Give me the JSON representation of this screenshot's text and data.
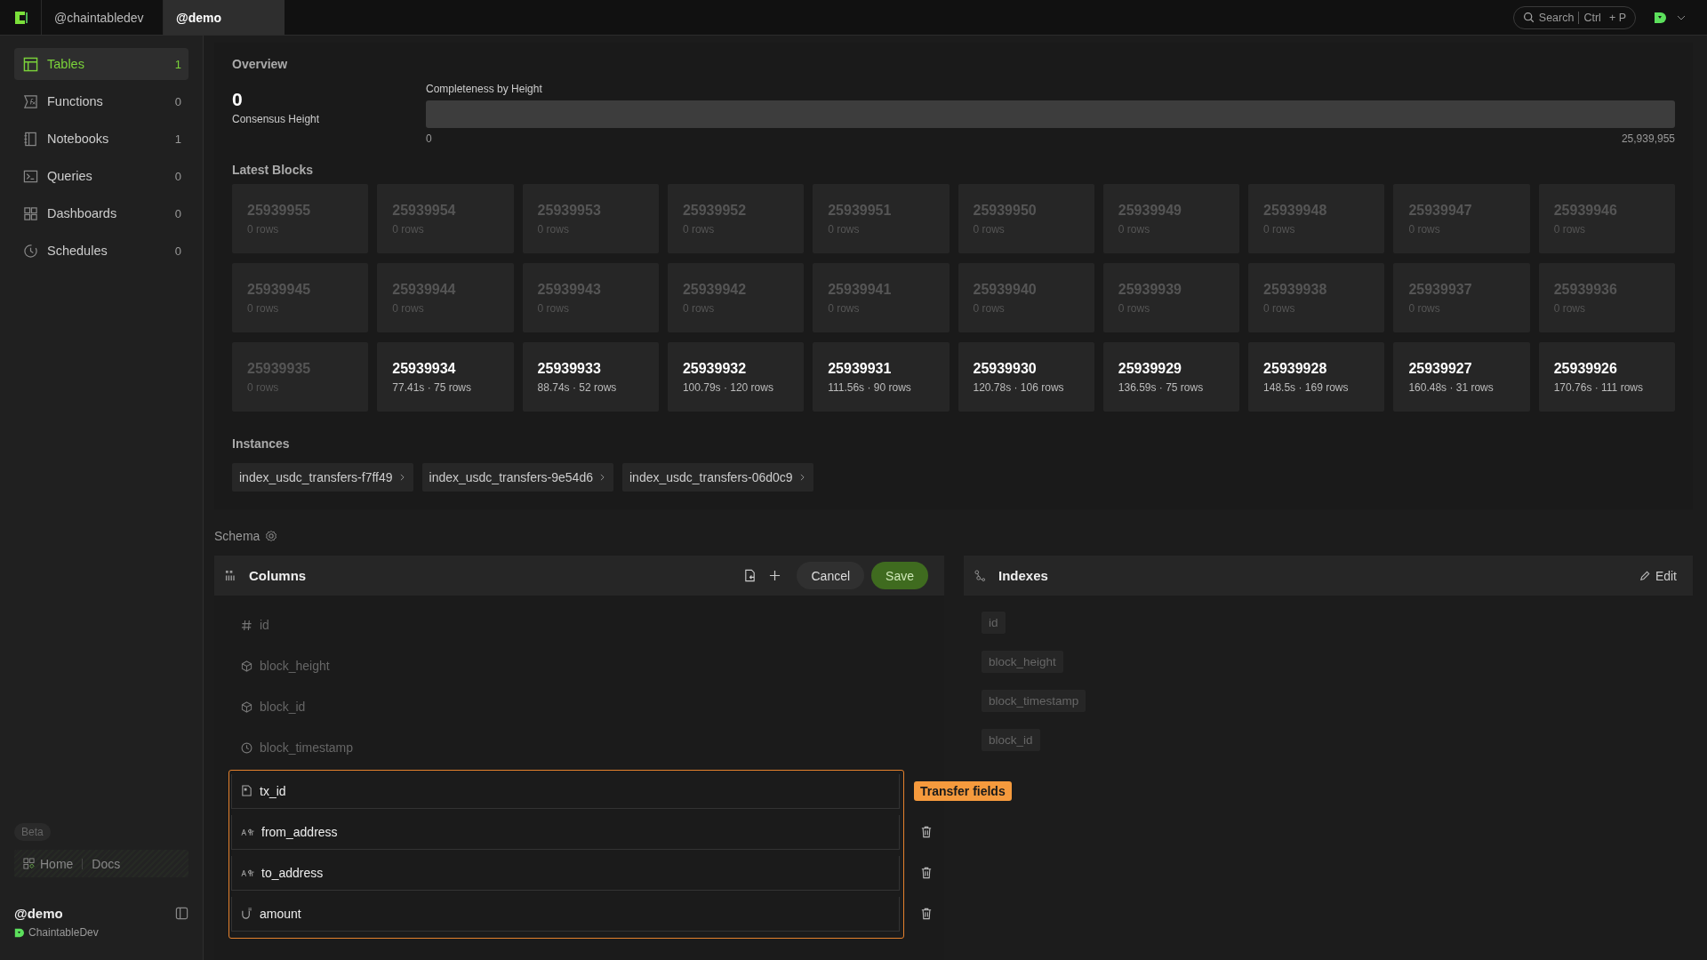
{
  "workspace_tabs": [
    {
      "label": "@chaintabledev",
      "selected": false
    },
    {
      "label": "@demo",
      "selected": true
    }
  ],
  "search": {
    "label": "Search",
    "shortcut_key": "Ctrl",
    "shortcut_plus": "+ P"
  },
  "sidebar": {
    "items": [
      {
        "kind": "tables",
        "label": "Tables",
        "count": "1",
        "selected": true
      },
      {
        "kind": "functions",
        "label": "Functions",
        "count": "0",
        "selected": false
      },
      {
        "kind": "notebooks",
        "label": "Notebooks",
        "count": "1",
        "selected": false
      },
      {
        "kind": "queries",
        "label": "Queries",
        "count": "0",
        "selected": false
      },
      {
        "kind": "dashboards",
        "label": "Dashboards",
        "count": "0",
        "selected": false
      },
      {
        "kind": "schedules",
        "label": "Schedules",
        "count": "0",
        "selected": false
      }
    ],
    "beta_badge": "Beta",
    "home_link": "Home",
    "docs_link": "Docs",
    "account_name": "@demo",
    "account_org": "ChaintableDev"
  },
  "overview": {
    "title": "Overview",
    "consensus_value": "0",
    "consensus_label": "Consensus Height",
    "completeness_label": "Completeness by Height",
    "completeness": {
      "level": 0
    },
    "range_start": "0",
    "range_end": "25,939,955"
  },
  "latest_blocks": {
    "title": "Latest Blocks",
    "blocks": [
      {
        "number": "25939955",
        "detail": "0 rows",
        "kind": "empty"
      },
      {
        "number": "25939954",
        "detail": "0 rows",
        "kind": "empty"
      },
      {
        "number": "25939953",
        "detail": "0 rows",
        "kind": "empty"
      },
      {
        "number": "25939952",
        "detail": "0 rows",
        "kind": "empty"
      },
      {
        "number": "25939951",
        "detail": "0 rows",
        "kind": "empty"
      },
      {
        "number": "25939950",
        "detail": "0 rows",
        "kind": "empty"
      },
      {
        "number": "25939949",
        "detail": "0 rows",
        "kind": "empty"
      },
      {
        "number": "25939948",
        "detail": "0 rows",
        "kind": "empty"
      },
      {
        "number": "25939947",
        "detail": "0 rows",
        "kind": "empty"
      },
      {
        "number": "25939946",
        "detail": "0 rows",
        "kind": "empty"
      },
      {
        "number": "25939945",
        "detail": "0 rows",
        "kind": "empty"
      },
      {
        "number": "25939944",
        "detail": "0 rows",
        "kind": "empty"
      },
      {
        "number": "25939943",
        "detail": "0 rows",
        "kind": "empty"
      },
      {
        "number": "25939942",
        "detail": "0 rows",
        "kind": "empty"
      },
      {
        "number": "25939941",
        "detail": "0 rows",
        "kind": "empty"
      },
      {
        "number": "25939940",
        "detail": "0 rows",
        "kind": "empty"
      },
      {
        "number": "25939939",
        "detail": "0 rows",
        "kind": "empty"
      },
      {
        "number": "25939938",
        "detail": "0 rows",
        "kind": "empty"
      },
      {
        "number": "25939937",
        "detail": "0 rows",
        "kind": "empty"
      },
      {
        "number": "25939936",
        "detail": "0 rows",
        "kind": "empty"
      },
      {
        "number": "25939935",
        "detail": "0 rows",
        "kind": "empty"
      },
      {
        "number": "25939934",
        "detail": "77.41s · 75 rows",
        "kind": "filled"
      },
      {
        "number": "25939933",
        "detail": "88.74s · 52 rows",
        "kind": "filled"
      },
      {
        "number": "25939932",
        "detail": "100.79s · 120 rows",
        "kind": "filled"
      },
      {
        "number": "25939931",
        "detail": "111.56s · 90 rows",
        "kind": "filled"
      },
      {
        "number": "25939930",
        "detail": "120.78s · 106 rows",
        "kind": "filled"
      },
      {
        "number": "25939929",
        "detail": "136.59s · 75 rows",
        "kind": "filled"
      },
      {
        "number": "25939928",
        "detail": "148.5s · 169 rows",
        "kind": "filled"
      },
      {
        "number": "25939927",
        "detail": "160.48s · 31 rows",
        "kind": "filled"
      },
      {
        "number": "25939926",
        "detail": "170.76s · 111 rows",
        "kind": "filled"
      }
    ]
  },
  "instances": {
    "title": "Instances",
    "items": [
      "index_usdc_transfers-f7ff49",
      "index_usdc_transfers-9e54d6",
      "index_usdc_transfers-06d0c9"
    ]
  },
  "schema": {
    "title": "Schema",
    "columns": {
      "title": "Columns",
      "cancel": "Cancel",
      "save": "Save",
      "fixed": [
        {
          "name": "id",
          "kind": "number"
        },
        {
          "name": "block_height",
          "kind": "block"
        },
        {
          "name": "block_id",
          "kind": "block"
        },
        {
          "name": "block_timestamp",
          "kind": "time"
        }
      ],
      "group": {
        "tag": "Transfer fields",
        "fields": [
          {
            "name": "tx_id",
            "kind": "txid",
            "deletable": false
          },
          {
            "name": "from_address",
            "kind": "address",
            "deletable": true
          },
          {
            "name": "to_address",
            "kind": "address",
            "deletable": true
          },
          {
            "name": "amount",
            "kind": "uint",
            "deletable": true
          }
        ]
      }
    },
    "indexes": {
      "title": "Indexes",
      "edit": "Edit",
      "items": [
        "id",
        "block_height",
        "block_timestamp",
        "block_id"
      ]
    }
  }
}
